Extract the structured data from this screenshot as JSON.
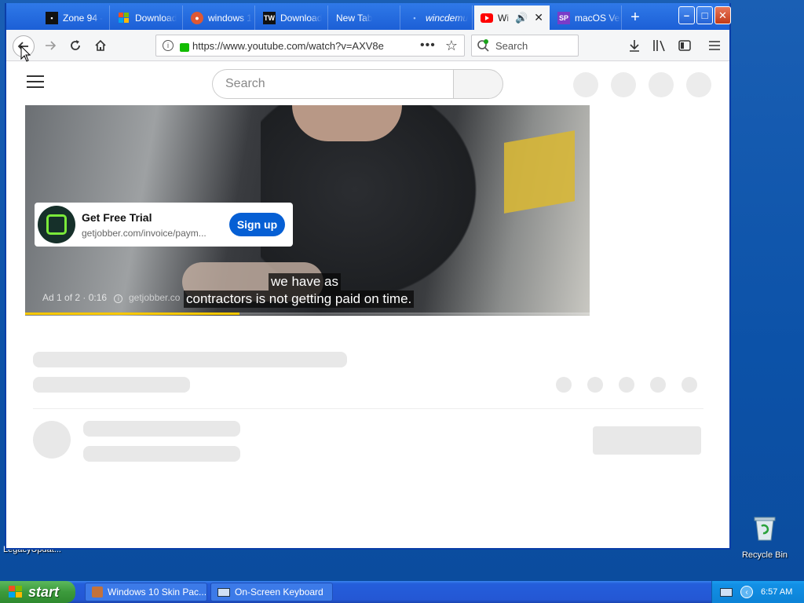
{
  "browser": {
    "tabs": [
      {
        "title": "Zone 94 -",
        "icon": "zone-icon"
      },
      {
        "title": "Download",
        "icon": "windows-logo-icon"
      },
      {
        "title": "windows 1",
        "icon": "duckduckgo-icon"
      },
      {
        "title": "Download",
        "icon": "tw-icon",
        "icon_text": "TW"
      },
      {
        "title": "New Tab",
        "icon": "none"
      },
      {
        "title": "wincdemu",
        "icon": "dot-icon"
      },
      {
        "title": "Wi",
        "icon": "youtube-icon",
        "active": true
      },
      {
        "title": "macOS Ver",
        "icon": "sp-icon",
        "icon_text": "SP"
      }
    ],
    "new_tab_label": "+",
    "window_controls": {
      "minimize": "–",
      "maximize": "□",
      "close": "✕"
    },
    "url": "https://www.youtube.com/watch?v=AXV8e",
    "search_placeholder": "Search",
    "accent_color": "#1c5fd6"
  },
  "youtube": {
    "search_placeholder": "Search",
    "ad": {
      "title": "Get Free Trial",
      "domain": "getjobber.com/invoice/paym...",
      "cta": "Sign up",
      "info": "Ad 1 of 2 · 0:16",
      "info_domain": "getjobber.co",
      "progress": 0.38
    },
    "captions": [
      "we have as",
      "contractors is not getting paid on time."
    ]
  },
  "desktop": {
    "icons": [
      {
        "label": "Recycle Bin",
        "icon": "recycle-bin-icon"
      }
    ],
    "partial_label": "LegacyUpdat..."
  },
  "taskbar": {
    "start_label": "start",
    "tasks": [
      {
        "label": "Windows 10 Skin Pac...",
        "icon": "app-icon"
      },
      {
        "label": "On-Screen Keyboard",
        "icon": "keyboard-icon"
      }
    ],
    "clock": "6:57 AM"
  }
}
